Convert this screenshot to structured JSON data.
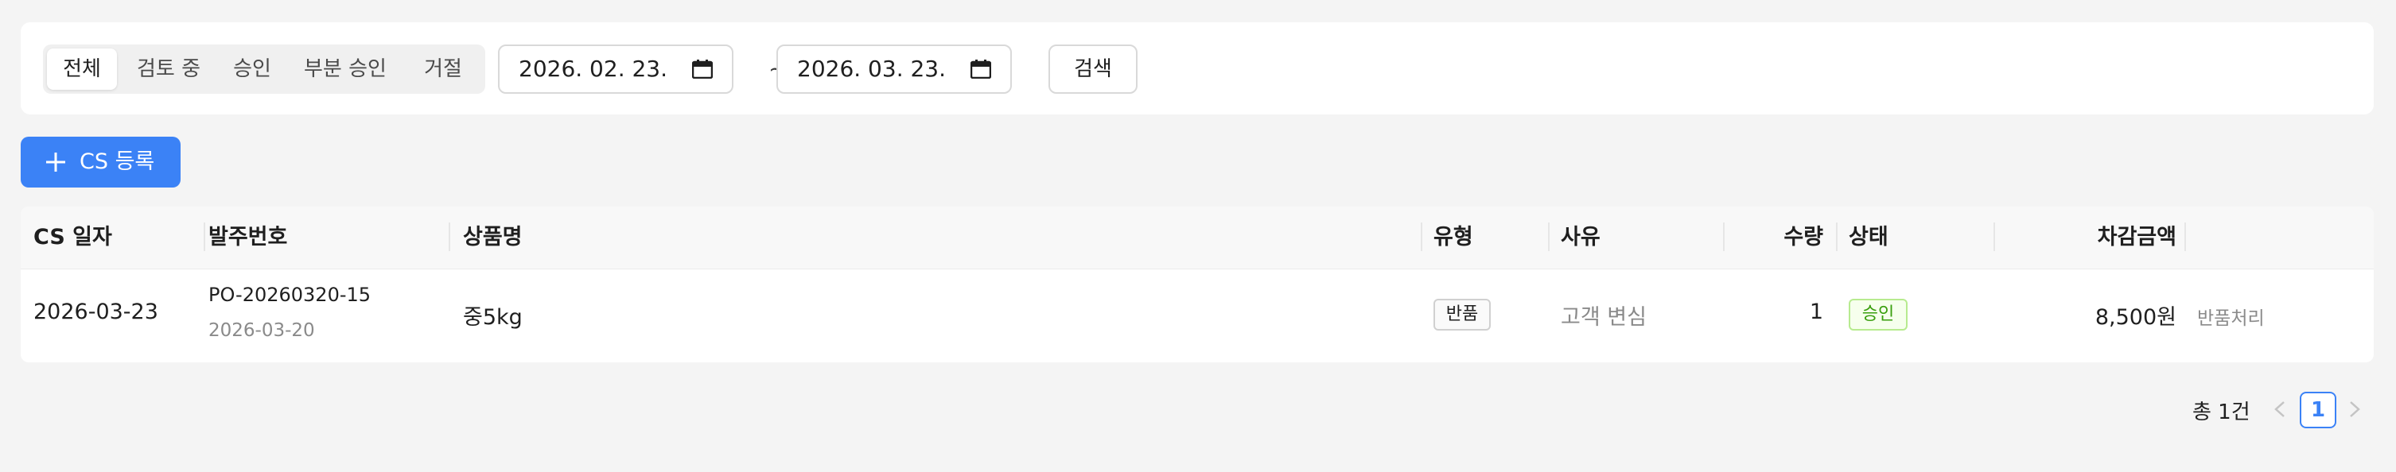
{
  "filter": {
    "tabs": [
      "전체",
      "검토 중",
      "승인",
      "부분 승인",
      "거절"
    ],
    "active_tab": "전체",
    "date_from": "2026. 02. 23.",
    "date_to": "2026. 03. 23.",
    "separator": "~",
    "search_label": "검색"
  },
  "actions": {
    "add_cs_label": "CS 등록"
  },
  "table": {
    "columns": [
      "CS 일자",
      "발주번호",
      "상품명",
      "유형",
      "사유",
      "수량",
      "상태",
      "차감금액"
    ],
    "rows": [
      {
        "cs_date": "2026-03-23",
        "order_no": "PO-20260320-15",
        "order_date": "2026-03-20",
        "product": "중5kg",
        "type": "반품",
        "reason": "고객 변심",
        "qty": "1",
        "status": "승인",
        "deduction": "8,500원",
        "note": "반품처리"
      }
    ]
  },
  "pagination": {
    "total": "총 1건",
    "current": "1"
  },
  "colors": {
    "accent": "#3b82f6",
    "approved": "#389e0d",
    "background": "#f4f4f4"
  }
}
